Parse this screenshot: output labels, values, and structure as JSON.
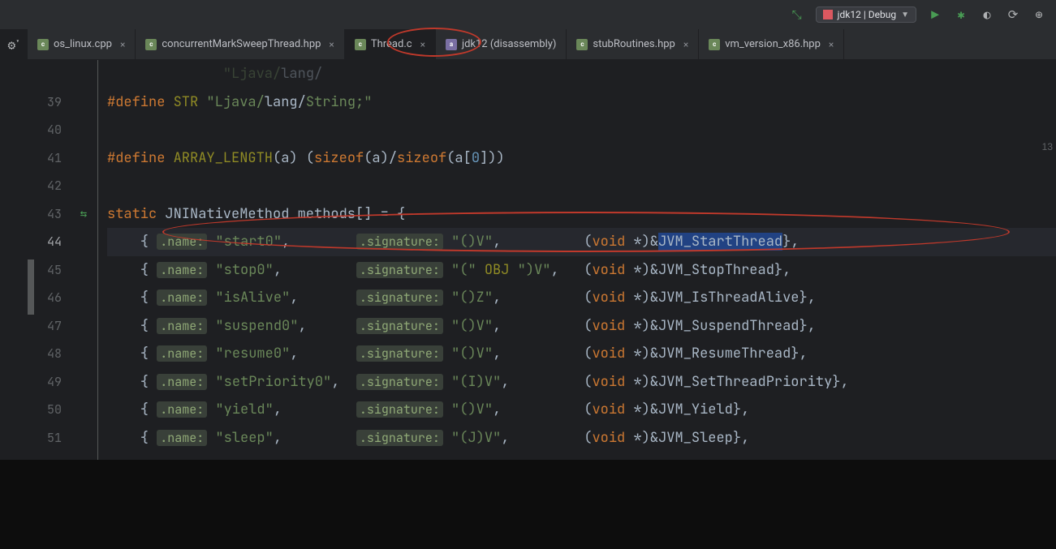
{
  "run_config": {
    "label": "jdk12 | Debug"
  },
  "tabs": [
    {
      "label": "os_linux.cpp",
      "kind": "c",
      "active": false
    },
    {
      "label": "concurrentMarkSweepThread.hpp",
      "kind": "c",
      "active": false
    },
    {
      "label": "Thread.c",
      "kind": "c",
      "active": true
    },
    {
      "label": "jdk12 (disassembly)",
      "kind": "asm",
      "active": false
    },
    {
      "label": "stubRoutines.hpp",
      "kind": "c",
      "active": false
    },
    {
      "label": "vm_version_x86.hpp",
      "kind": "c",
      "active": false
    }
  ],
  "right_hint": "13",
  "lines": {
    "start": 39,
    "end": 51,
    "top_partial": {
      "frag_str1": "\"Ljava/",
      "frag_str2": "lang/"
    },
    "l39": {
      "define": "#define",
      "name": "STR",
      "s1": "\"Ljava/",
      "s2": "lang/",
      "s3": "String;\""
    },
    "l41": {
      "define": "#define",
      "name": "ARRAY_LENGTH",
      "args": "(a)",
      "sizeof": "sizeof",
      "a": "a",
      "zero": "0"
    },
    "l43": {
      "static": "static",
      "type": "JNINativeMethod",
      "var": "methods",
      "brack": "[] = {"
    },
    "rows": [
      {
        "ln": 44,
        "name": "start0",
        "sig": "\"()V\"",
        "fn": "JVM_StartThread",
        "sel": true
      },
      {
        "ln": 45,
        "name": "stop0",
        "sig": "\"(\" OBJ \")V\"",
        "fn": "JVM_StopThread",
        "obj": true
      },
      {
        "ln": 46,
        "name": "isAlive",
        "sig": "\"()Z\"",
        "fn": "JVM_IsThreadAlive"
      },
      {
        "ln": 47,
        "name": "suspend0",
        "sig": "\"()V\"",
        "fn": "JVM_SuspendThread"
      },
      {
        "ln": 48,
        "name": "resume0",
        "sig": "\"()V\"",
        "fn": "JVM_ResumeThread"
      },
      {
        "ln": 49,
        "name": "setPriority0",
        "sig": "\"(I)V\"",
        "fn": "JVM_SetThreadPriority"
      },
      {
        "ln": 50,
        "name": "yield",
        "sig": "\"()V\"",
        "fn": "JVM_Yield"
      },
      {
        "ln": 51,
        "name": "sleep",
        "sig": "\"(J)V\"",
        "fn": "JVM_Sleep"
      }
    ],
    "hints": {
      "name": ".name:",
      "sig": ".signature:"
    }
  }
}
